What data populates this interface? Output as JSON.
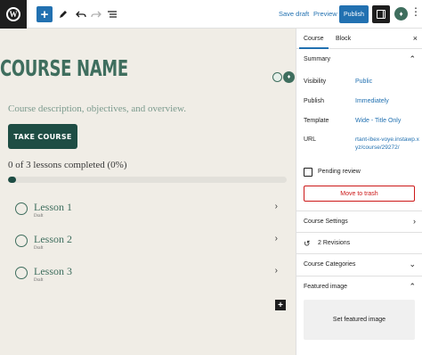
{
  "toolbar": {
    "add_icon": "plus-icon",
    "edit_icon": "pencil-icon",
    "undo_icon": "undo-icon",
    "redo_icon": "redo-icon",
    "list_view_icon": "list-view-icon",
    "save_draft_label": "Save draft",
    "preview_label": "Preview",
    "publish_label": "Publish",
    "settings_icon": "sidebar-toggle-icon",
    "plugin_icon": "sensei-icon",
    "more_icon": "more-vertical-icon",
    "accent_color": "#2271b1"
  },
  "canvas": {
    "course_title": "COURSE NAME",
    "course_description": "Course description, objectives, and overview.",
    "take_course_label": "TAKE COURSE",
    "progress_text": "0 of 3 lessons completed (0%)",
    "progress_percent": 0,
    "lessons": [
      {
        "title": "Lesson 1",
        "status": "Draft"
      },
      {
        "title": "Lesson 2",
        "status": "Draft"
      },
      {
        "title": "Lesson 3",
        "status": "Draft"
      }
    ],
    "theme_color": "#3f6e5e",
    "background_color": "#f0ede6"
  },
  "sidebar": {
    "tabs": [
      {
        "label": "Course",
        "active": true
      },
      {
        "label": "Block",
        "active": false
      }
    ],
    "summary": {
      "heading": "Summary",
      "visibility_label": "Visibility",
      "visibility_value": "Public",
      "publish_label": "Publish",
      "publish_value": "Immediately",
      "template_label": "Template",
      "template_value": "Wide - Title Only",
      "url_label": "URL",
      "url_value": "rtant-ibex-voye.instawp.xyz/course/29272/",
      "pending_review_label": "Pending review",
      "pending_review_checked": false,
      "trash_label": "Move to trash"
    },
    "course_settings_label": "Course Settings",
    "revisions_label": "2 Revisions",
    "course_categories_label": "Course Categories",
    "featured_image_label": "Featured image",
    "set_featured_image_label": "Set featured image"
  }
}
